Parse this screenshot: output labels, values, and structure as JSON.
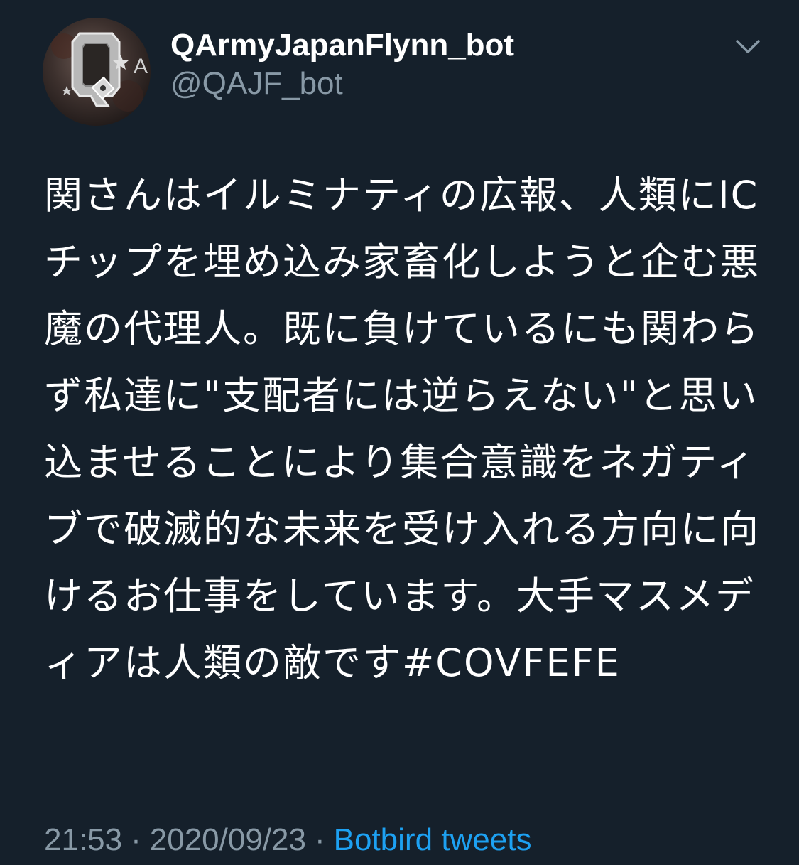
{
  "tweet": {
    "author": {
      "display_name": "QArmyJapanFlynn_bot",
      "handle": "@QAJF_bot",
      "avatar_icon": "q-army-logo-avatar",
      "avatar_letters": "A"
    },
    "menu_icon": "chevron-down-icon",
    "text_before_hashtag": "関さんはイルミナティの広報、人類にICチップを埋め込み家畜化しようと企む悪魔の代理人。既に負けているにも関わらず私達に\"支配者には逆らえない\"と思い込ませることにより集合意識をネガティブで破滅的な未来を受け入れる方向に向けるお仕事をしています。大手マスメディアは人類の敵です",
    "hashtag": "#COVFEFE",
    "time": "21:53",
    "date": "2020/09/23",
    "separator": "·",
    "source": "Botbird tweets"
  },
  "colors": {
    "background": "#15202b",
    "primary_text": "#ffffff",
    "secondary_text": "#8899a6",
    "link": "#1da1f2"
  }
}
